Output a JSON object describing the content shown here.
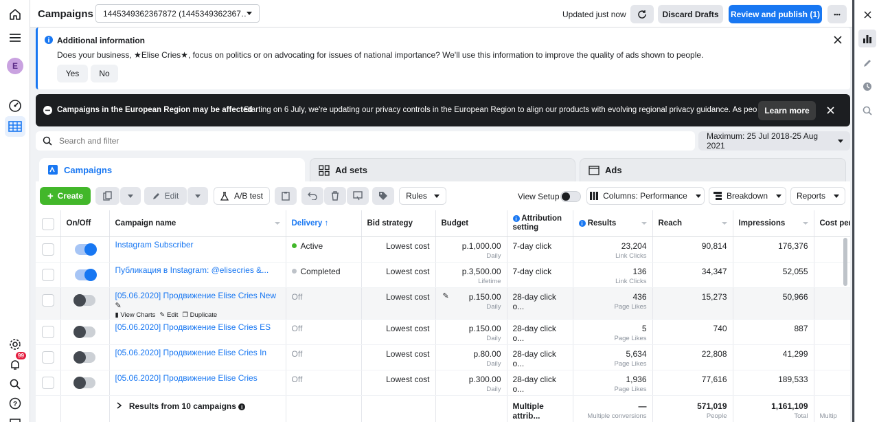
{
  "colors": {
    "accent": "#1877f2",
    "create_green": "#42b72a",
    "active_dot": "#42b72a",
    "completed_dot": "#bec3c9",
    "banner_bg": "#1c1e21"
  },
  "left_nav": {
    "avatar_initial": "E",
    "notification_count": "99",
    "icons": [
      "home-icon",
      "menu-icon",
      "avatar",
      "dashboard-icon",
      "campaigns-grid-icon",
      "settings-icon",
      "notifications-icon",
      "search-icon",
      "help-icon"
    ]
  },
  "header": {
    "title": "Campaigns",
    "account_select": "1445349362367872 (1445349362367…",
    "status": "Updated just now",
    "discard_label": "Discard Drafts",
    "publish_label": "Review and publish (1)",
    "more_label": "•••"
  },
  "info_box": {
    "title": "Additional information",
    "message": "Does your business, ★Elise Cries★, focus on politics or on advocating for issues of national importance? We'll use this information to improve the quality of ads shown to people.",
    "yes": "Yes",
    "no": "No"
  },
  "banner": {
    "title": "Campaigns in the European Region may be affected",
    "text": "Starting on 6 July, we're updating our privacy controls in the European Region to align our products with evolving regional privacy guidance. As peo…",
    "learn_more": "Learn more"
  },
  "search": {
    "placeholder": "Search and filter"
  },
  "date_range": "Maximum: 25 Jul 2018-25 Aug 2021",
  "tabs": [
    {
      "label": "Campaigns"
    },
    {
      "label": "Ad sets"
    },
    {
      "label": "Ads"
    }
  ],
  "toolbar": {
    "create": "Create",
    "edit": "Edit",
    "ab_test": "A/B test",
    "rules": "Rules",
    "view_setup": "View Setup",
    "columns": "Columns: Performance",
    "breakdown": "Breakdown",
    "reports": "Reports"
  },
  "table": {
    "headers": {
      "onoff": "On/Off",
      "name": "Campaign name",
      "delivery": "Delivery ↑",
      "bid": "Bid strategy",
      "budget": "Budget",
      "attribution": "Attribution setting",
      "results": "Results",
      "reach": "Reach",
      "impressions": "Impressions",
      "cost": "Cost per"
    },
    "row_actions": {
      "view_charts": "View Charts",
      "edit": "Edit",
      "duplicate": "Duplicate"
    },
    "rows": [
      {
        "on": true,
        "name": "Instagram Subscriber",
        "delivery": "Active",
        "delivery_state": "active",
        "bid": "Lowest cost",
        "budget": "p.1,000.00",
        "budget_type": "Daily",
        "attribution": "7-day click",
        "results": "23,204",
        "results_type": "Link Clicks",
        "reach": "90,814",
        "impressions": "176,376"
      },
      {
        "on": true,
        "name": "Публикация в Instagram: @elisecries &...",
        "delivery": "Completed",
        "delivery_state": "completed",
        "bid": "Lowest cost",
        "budget": "p.3,500.00",
        "budget_type": "Lifetime",
        "attribution": "7-day click",
        "results": "136",
        "results_type": "Link Clicks",
        "reach": "34,347",
        "impressions": "52,055"
      },
      {
        "on": false,
        "name": "[05.06.2020] Продвижение Elise Cries New",
        "delivery": "Off",
        "delivery_state": "off",
        "bid": "Lowest cost",
        "budget": "p.150.00",
        "budget_type": "Daily",
        "attribution": "28-day click o...",
        "results": "436",
        "results_type": "Page Likes",
        "reach": "15,273",
        "impressions": "50,966",
        "hovered": true
      },
      {
        "on": false,
        "name": "[05.06.2020] Продвижение Elise Cries ES",
        "delivery": "Off",
        "delivery_state": "off",
        "bid": "Lowest cost",
        "budget": "p.150.00",
        "budget_type": "Daily",
        "attribution": "28-day click o...",
        "results": "5",
        "results_type": "Page Likes",
        "reach": "740",
        "impressions": "887"
      },
      {
        "on": false,
        "name": "[05.06.2020] Продвижение Elise Cries In",
        "delivery": "Off",
        "delivery_state": "off",
        "bid": "Lowest cost",
        "budget": "p.80.00",
        "budget_type": "Daily",
        "attribution": "28-day click o...",
        "results": "5,634",
        "results_type": "Page Likes",
        "reach": "22,808",
        "impressions": "41,299"
      },
      {
        "on": false,
        "name": "[05.06.2020] Продвижение Elise Cries",
        "delivery": "Off",
        "delivery_state": "off",
        "bid": "Lowest cost",
        "budget": "p.300.00",
        "budget_type": "Daily",
        "attribution": "28-day click o...",
        "results": "1,936",
        "results_type": "Page Likes",
        "reach": "77,616",
        "impressions": "189,533"
      }
    ],
    "footer": {
      "label": "Results from 10 campaigns",
      "attribution": "Multiple attrib...",
      "results": "—",
      "results_sub": "Multiple conversions",
      "reach": "571,019",
      "reach_sub": "People",
      "impressions": "1,161,109",
      "impressions_sub": "Total",
      "cost_sub": "Multip"
    }
  }
}
